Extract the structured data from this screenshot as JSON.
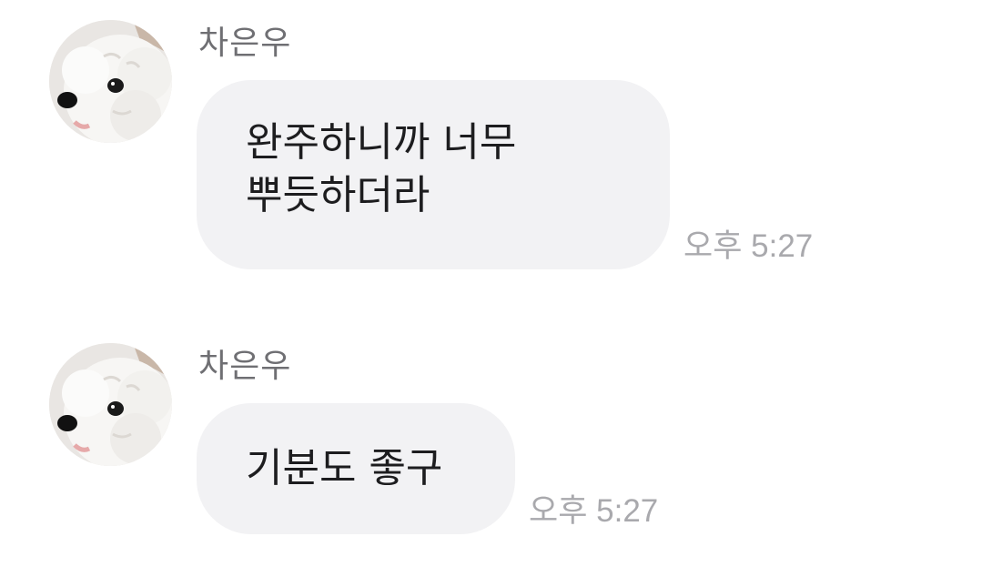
{
  "messages": [
    {
      "sender": "차은우",
      "avatar_icon": "dog-avatar-icon",
      "text": "완주하니까 너무\n뿌듯하더라",
      "time": "오후 5:27"
    },
    {
      "sender": "차은우",
      "avatar_icon": "dog-avatar-icon",
      "text": "기분도 좋구",
      "time": "오후 5:27"
    }
  ],
  "colors": {
    "background": "#ffffff",
    "bubble": "#f2f2f4",
    "sender_text": "#6f6f73",
    "time_text": "#a9a9ad",
    "message_text": "#1d1d1f"
  }
}
